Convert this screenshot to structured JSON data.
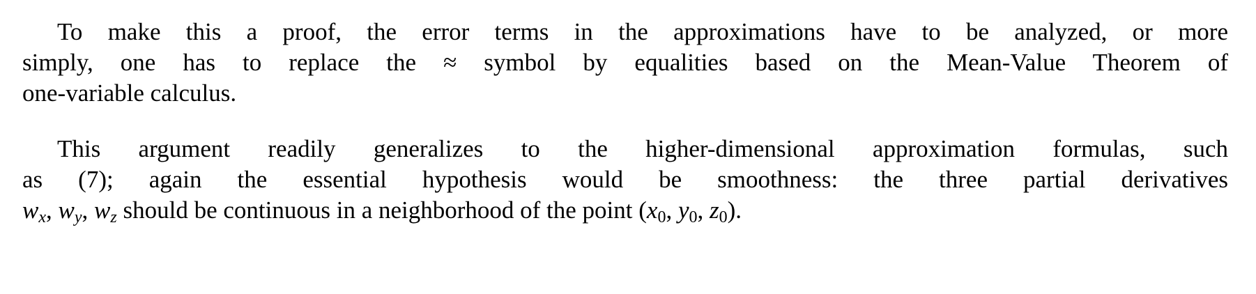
{
  "paragraphs": [
    {
      "lines": [
        "To make this a proof, the error terms in the approximations have to be analyzed, or more",
        "simply, one has to replace the ≈ symbol by equalities based on the Mean-Value Theorem of",
        "one-variable calculus."
      ]
    },
    {
      "lines": [
        "This argument readily generalizes to the higher-dimensional approximation formulas, such",
        "as (7); again the essential hypothesis would be smoothness: the three partial derivatives"
      ],
      "last_line": {
        "math_vars": [
          "w",
          "x",
          "w",
          "y",
          "w",
          "z"
        ],
        "text": " should be continuous in a neighborhood of the point ",
        "point": {
          "x": "x",
          "y": "y",
          "z": "z",
          "sub": "0"
        },
        "end": "."
      }
    }
  ]
}
